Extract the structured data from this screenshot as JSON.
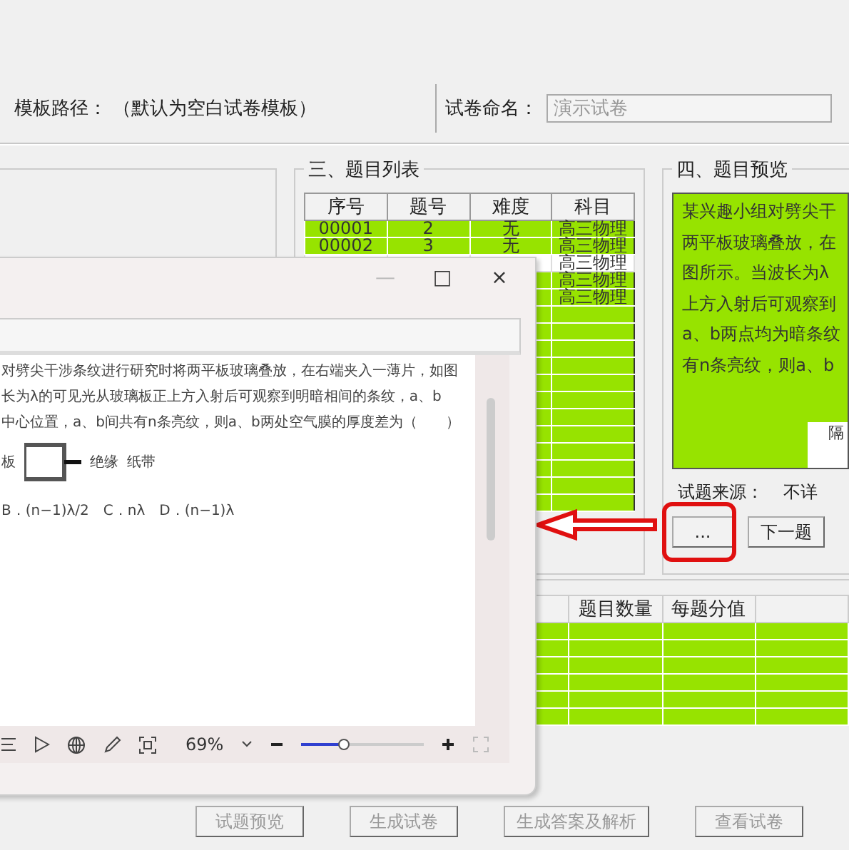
{
  "template": {
    "label": "模板路径：",
    "value": "（默认为空白试卷模板）"
  },
  "paper_name": {
    "label": "试卷命名：",
    "value": "演示试卷"
  },
  "question_list": {
    "title": "三、题目列表",
    "columns": [
      "序号",
      "题号",
      "难度",
      "科目"
    ],
    "rows": [
      {
        "number": "00001",
        "qno": "2",
        "difficulty": "无",
        "subject": "高三物理",
        "selected": false
      },
      {
        "number": "00002",
        "qno": "3",
        "difficulty": "无",
        "subject": "高三物理",
        "selected": false
      },
      {
        "subject": "高三物理",
        "selected": true
      },
      {
        "subject": "高三物理",
        "selected": false
      },
      {
        "subject": "高三物理",
        "selected": false
      }
    ]
  },
  "preview": {
    "title": "四、题目预览",
    "lines": [
      "某兴趣小组对劈尖干",
      "两平板玻璃叠放，在",
      "图所示。当波长为λ",
      "上方入射后可观察到",
      "a、b两点均为暗条纹",
      "有n条亮纹，则a、b"
    ],
    "figure_caption": "隔",
    "source_label": "试题来源：",
    "source_value": "不详",
    "buttons": [
      {
        "label": "...",
        "highlighted": true
      },
      {
        "label": "下一题",
        "highlighted": false
      }
    ]
  },
  "score_table": {
    "columns": [
      "题目数量",
      "每题分值"
    ]
  },
  "bottom_buttons": [
    {
      "label": "试题预览",
      "disabled": true
    },
    {
      "label": "生成试卷",
      "disabled": true
    },
    {
      "label": "生成答案及解析",
      "disabled": true
    },
    {
      "label": "查看试卷",
      "disabled": true
    }
  ],
  "viewer": {
    "controls": [
      "—",
      "□",
      "×"
    ],
    "lines": [
      "对劈尖干涉条纹进行研究时将两平板玻璃叠放，在右端夹入一薄片，如图",
      "长为λ的可见光从玻璃板正上方入射后可观察到明暗相间的条纹，a、b",
      "中心位置，a、b间共有n条亮纹，则a、b两处空气膜的厚度差为（　　）"
    ],
    "figure_labels": [
      "板",
      "绝缘",
      "纸带"
    ],
    "options": "B．(n−1)λ/2　C．nλ　D．(n−1)λ",
    "zoom": {
      "value": "69%",
      "level": 0.35
    }
  }
}
